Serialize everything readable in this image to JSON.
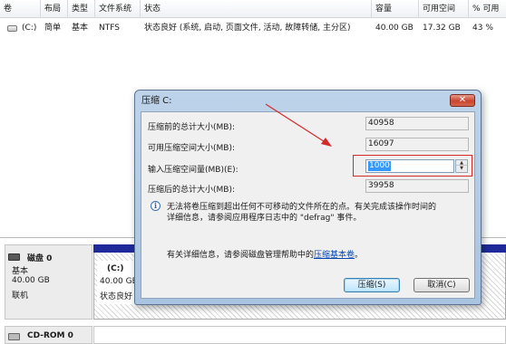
{
  "volume_list": {
    "headers": [
      "卷",
      "布局",
      "类型",
      "文件系统",
      "状态",
      "容量",
      "可用空间",
      "% 可用"
    ],
    "row": {
      "volume": "(C:)",
      "layout": "简单",
      "type": "基本",
      "filesystem": "NTFS",
      "status": "状态良好 (系统, 启动, 页面文件, 活动, 故障转储, 主分区)",
      "capacity": "40.00 GB",
      "free": "17.32 GB",
      "percent_free": "43 %"
    }
  },
  "disk_panel": {
    "disk_label": "磁盘 0",
    "disk_type": "基本",
    "disk_size": "40.00 GB",
    "disk_state": "联机",
    "partition_name": "(C:)",
    "partition_size": "40.00 GB",
    "partition_status": "状态良好",
    "cdrom_label": "CD-ROM 0"
  },
  "dialog": {
    "title": "压缩 C:",
    "close_symbol": "✕",
    "total_before_label": "压缩前的总计大小(MB):",
    "total_before_value": "40958",
    "available_label": "可用压缩空间大小(MB):",
    "available_value": "16097",
    "input_label": "输入压缩空间量(MB)(E):",
    "input_value": "1000",
    "total_after_label": "压缩后的总计大小(MB):",
    "total_after_value": "39958",
    "info_line1": "无法将卷压缩到超出任何不可移动的文件所在的点。有关完成该操作时间的",
    "info_line2": "详细信息，请参阅应用程序日志中的 \"defrag\" 事件。",
    "help_prefix": "有关详细信息，请参阅磁盘管理帮助中的",
    "help_link": "压缩基本卷",
    "help_suffix": "。",
    "shrink_button": "压缩(S)",
    "cancel_button": "取消(C)"
  },
  "icons": {
    "drive": "drive-icon",
    "disk": "disk-icon",
    "cdrom": "cdrom-icon",
    "info": "info-icon",
    "close": "close-icon",
    "spinner_up": "chevron-up-icon",
    "spinner_down": "chevron-down-icon"
  },
  "colors": {
    "partition_stripe": "#1e2a9a",
    "annotation": "#d52a2a",
    "selection": "#3399ff"
  }
}
